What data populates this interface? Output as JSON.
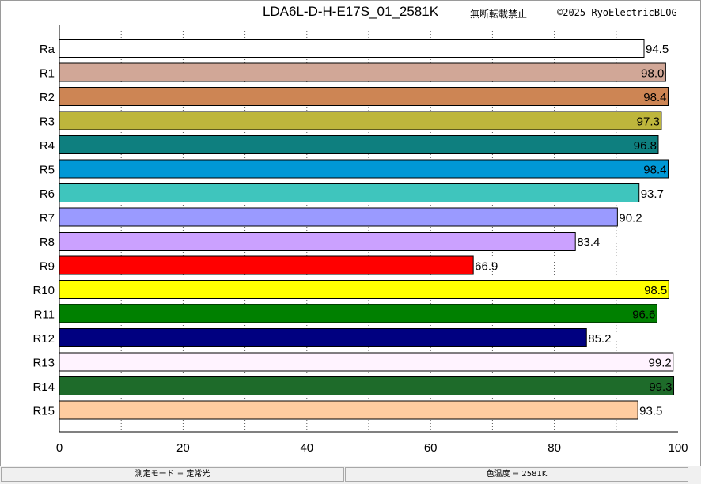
{
  "header": {
    "notice": "無断転載禁止",
    "copyright": "©2025 RyoElectricBLOG"
  },
  "chart_data": {
    "type": "bar",
    "orientation": "horizontal",
    "title": "LDA6L-D-H-E17S_01_2581K",
    "categories": [
      "Ra",
      "R1",
      "R2",
      "R3",
      "R4",
      "R5",
      "R6",
      "R7",
      "R8",
      "R9",
      "R10",
      "R11",
      "R12",
      "R13",
      "R14",
      "R15"
    ],
    "values": [
      94.5,
      98.0,
      98.4,
      97.3,
      96.8,
      98.4,
      93.7,
      90.2,
      83.4,
      66.9,
      98.5,
      96.6,
      85.2,
      99.2,
      99.3,
      93.5
    ],
    "value_labels": [
      "94.5",
      "98.0",
      "98.4",
      "97.3",
      "96.8",
      "98.4",
      "93.7",
      "90.2",
      "83.4",
      "66.9",
      "98.5",
      "96.6",
      "85.2",
      "99.2",
      "99.3",
      "93.5"
    ],
    "colors": [
      "#ffffff",
      "#d1a797",
      "#cd8554",
      "#beb63c",
      "#0e7f7f",
      "#0098d6",
      "#3fc5bd",
      "#9a9aff",
      "#cba1ff",
      "#ff0000",
      "#ffff00",
      "#008000",
      "#000080",
      "#fff3ff",
      "#1e6b2a",
      "#ffcca0"
    ],
    "label_colors": [
      "#000000",
      "#000000",
      "#000000",
      "#000000",
      "#000000",
      "#000000",
      "#000000",
      "#000000",
      "#000000",
      "#000000",
      "#000000",
      "#000000",
      "#000000",
      "#000000",
      "#000000",
      "#000000"
    ],
    "xlim": [
      0,
      100
    ],
    "xticks": [
      "0",
      "20",
      "40",
      "60",
      "80",
      "100"
    ],
    "grid": true,
    "xlabel": "",
    "ylabel": ""
  },
  "status": {
    "mode": "測定モード = 定常光",
    "cct": "色温度 = 2581K"
  }
}
